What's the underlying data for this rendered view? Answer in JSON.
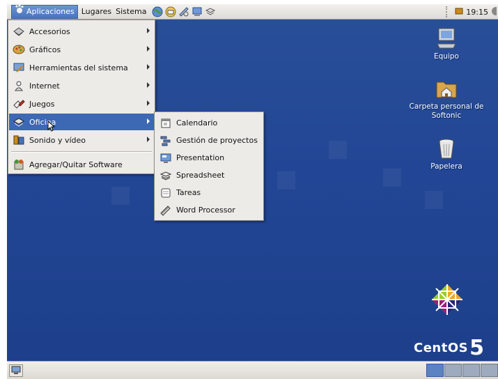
{
  "top_panel": {
    "applications": "Aplicaciones",
    "places": "Lugares",
    "system": "Sistema",
    "launchers": [
      "globe-launcher-icon",
      "mail-launcher-icon",
      "notes-launcher-icon",
      "presentation-launcher-icon",
      "spreadsheet-launcher-icon"
    ],
    "clock": "19:15"
  },
  "apps_menu": {
    "items": [
      {
        "label": "Accesorios",
        "icon": "accessories-icon",
        "submenu": true
      },
      {
        "label": "Gráficos",
        "icon": "graphics-icon",
        "submenu": true
      },
      {
        "label": "Herramientas del sistema",
        "icon": "system-tools-icon",
        "submenu": true
      },
      {
        "label": "Internet",
        "icon": "internet-icon",
        "submenu": true
      },
      {
        "label": "Juegos",
        "icon": "games-icon",
        "submenu": true
      },
      {
        "label": "Oficina",
        "icon": "office-icon",
        "submenu": true,
        "active": true
      },
      {
        "label": "Sonido y vídeo",
        "icon": "sound-video-icon",
        "submenu": true
      }
    ],
    "footer_item": {
      "label": "Agregar/Quitar Software",
      "icon": "add-remove-software-icon"
    }
  },
  "office_submenu": {
    "items": [
      {
        "label": "Calendario",
        "icon": "calendar-icon"
      },
      {
        "label": "Gestión de proyectos",
        "icon": "project-management-icon"
      },
      {
        "label": "Presentation",
        "icon": "presentation-icon"
      },
      {
        "label": "Spreadsheet",
        "icon": "spreadsheet-icon"
      },
      {
        "label": "Tareas",
        "icon": "tasks-icon"
      },
      {
        "label": "Word Processor",
        "icon": "word-processor-icon"
      }
    ]
  },
  "desktop_icons": [
    {
      "label": "Equipo",
      "icon": "computer-icon"
    },
    {
      "label": "Carpeta personal de Softonic",
      "icon": "home-folder-icon"
    },
    {
      "label": "Papelera",
      "icon": "trash-icon"
    }
  ],
  "branding": {
    "name": "CentOS",
    "version": "5"
  },
  "colors": {
    "desktop": "#224695",
    "menu_highlight": "#3d68b3",
    "menu_bg": "#edebe7",
    "panel": "#e6e3de"
  }
}
